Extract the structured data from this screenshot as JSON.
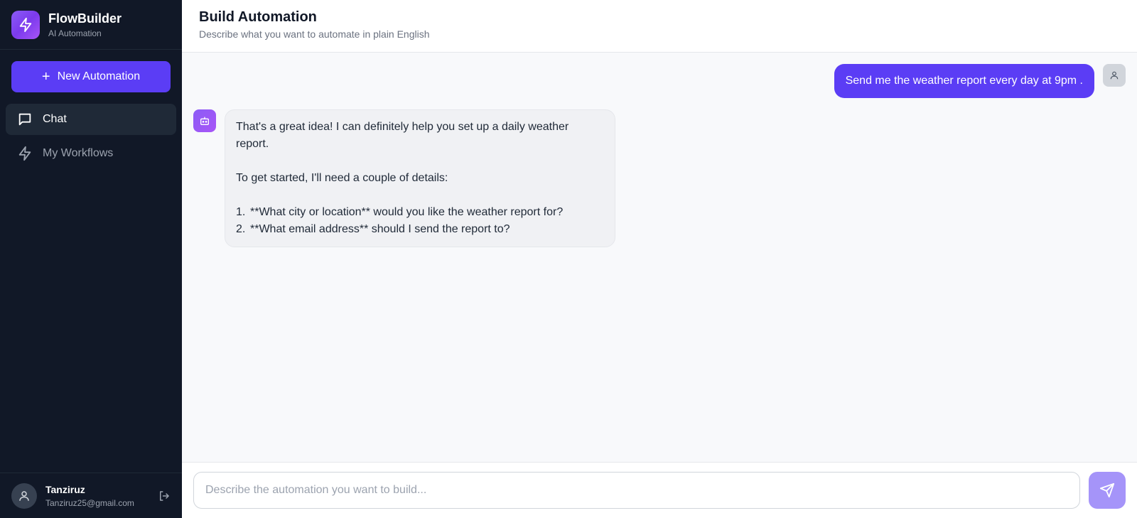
{
  "brand": {
    "name": "FlowBuilder",
    "subtitle": "AI Automation"
  },
  "sidebar": {
    "new_button_label": "New Automation",
    "items": [
      {
        "label": "Chat",
        "icon": "chat-bubble-icon",
        "active": true
      },
      {
        "label": "My Workflows",
        "icon": "lightning-icon",
        "active": false
      }
    ]
  },
  "user": {
    "name": "Tanziruz",
    "email": "Tanziruz25@gmail.com"
  },
  "header": {
    "title": "Build Automation",
    "subtitle": "Describe what you want to automate in plain English"
  },
  "chat": {
    "user_message": "Send me the weather report every day at 9pm .",
    "bot_message": {
      "line1": "That's a great idea! I can definitely help you set up a daily weather report.",
      "line2": "To get started, I'll need a couple of details:",
      "items": [
        {
          "num": "1.",
          "text": "**What city or location** would you like the weather report for?"
        },
        {
          "num": "2.",
          "text": "**What email address** should I send the report to?"
        }
      ]
    }
  },
  "composer": {
    "placeholder": "Describe the automation you want to build...",
    "value": ""
  },
  "colors": {
    "sidebar_bg": "#111827",
    "accent": "#5b3df5",
    "send_disabled": "#a594f9"
  }
}
